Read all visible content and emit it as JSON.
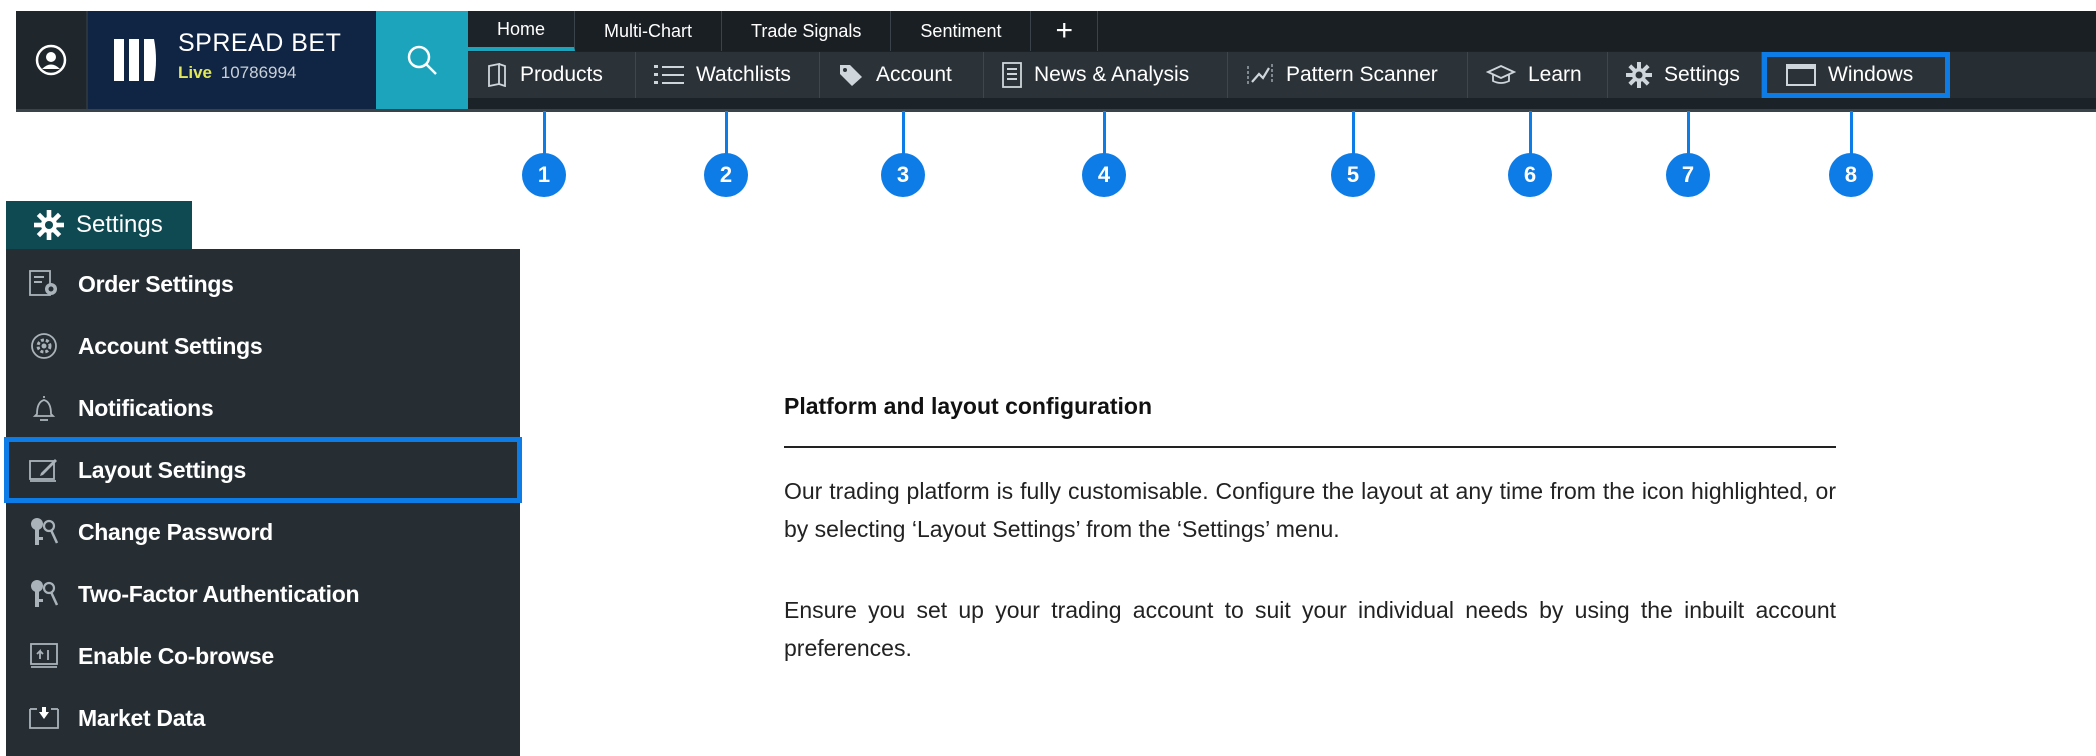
{
  "brand": {
    "title": "SPREAD BET",
    "live_label": "Live",
    "account_number": "10786994"
  },
  "tabs": [
    {
      "label": "Home",
      "active": true
    },
    {
      "label": "Multi-Chart",
      "active": false
    },
    {
      "label": "Trade Signals",
      "active": false
    },
    {
      "label": "Sentiment",
      "active": false
    },
    {
      "label": "+",
      "active": false
    }
  ],
  "menu": [
    {
      "label": "Products",
      "icon": "book-icon"
    },
    {
      "label": "Watchlists",
      "icon": "list-icon"
    },
    {
      "label": "Account",
      "icon": "tag-icon"
    },
    {
      "label": "News & Analysis",
      "icon": "document-icon"
    },
    {
      "label": "Pattern Scanner",
      "icon": "chart-trend-icon"
    },
    {
      "label": "Learn",
      "icon": "graduation-cap-icon"
    },
    {
      "label": "Settings",
      "icon": "gear-icon"
    },
    {
      "label": "Windows",
      "icon": "window-icon",
      "highlighted": true
    }
  ],
  "markers": [
    "1",
    "2",
    "3",
    "4",
    "5",
    "6",
    "7",
    "8"
  ],
  "settings_menu": {
    "title": "Settings",
    "items": [
      {
        "label": "Order Settings",
        "icon": "order-settings-icon"
      },
      {
        "label": "Account Settings",
        "icon": "account-settings-icon"
      },
      {
        "label": "Notifications",
        "icon": "bell-icon"
      },
      {
        "label": "Layout Settings",
        "icon": "layout-icon",
        "highlighted": true
      },
      {
        "label": "Change Password",
        "icon": "keys-icon"
      },
      {
        "label": "Two-Factor Authentication",
        "icon": "keys-icon"
      },
      {
        "label": "Enable Co-browse",
        "icon": "cobrowse-icon"
      },
      {
        "label": "Market Data",
        "icon": "market-data-icon"
      }
    ]
  },
  "description": {
    "heading": "Platform and layout configuration",
    "paragraphs": [
      "Our trading platform is fully customisable. Configure the layout at any time from the icon highlighted, or by selecting ‘Layout Settings’ from the ‘Settings’ menu.",
      "Ensure you set up your trading account to suit your individual needs by using the inbuilt account preferences."
    ]
  },
  "colors": {
    "accent_blue": "#0d7ce6",
    "teal": "#1ba4bb",
    "brand_navy": "#102444",
    "live_yellow": "#e2e85a",
    "bar_dark": "#1c2328"
  }
}
